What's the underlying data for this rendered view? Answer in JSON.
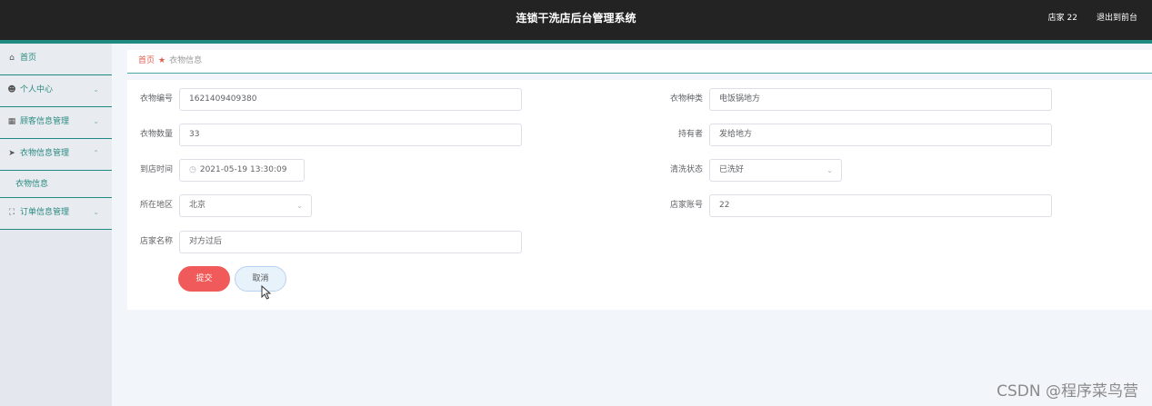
{
  "header": {
    "title": "连锁干洗店后台管理系统",
    "user": "店家 22",
    "exit": "退出到前台"
  },
  "sidebar": {
    "items": [
      {
        "icon": "home-icon",
        "label": "首页"
      },
      {
        "icon": "user-icon",
        "label": "个人中心"
      },
      {
        "icon": "document-icon",
        "label": "顾客信息管理"
      },
      {
        "icon": "send-icon",
        "label": "衣物信息管理",
        "expanded": true,
        "children": [
          {
            "label": "衣物信息"
          }
        ]
      },
      {
        "icon": "frame-icon",
        "label": "订单信息管理"
      }
    ]
  },
  "breadcrumb": {
    "home": "首页",
    "current": "衣物信息"
  },
  "form": {
    "clothing_no_label": "衣物编号",
    "clothing_no_value": "1621409409380",
    "clothing_type_label": "衣物种类",
    "clothing_type_value": "电饭锅地方",
    "clothing_qty_label": "衣物数量",
    "clothing_qty_value": "33",
    "owner_label": "持有者",
    "owner_value": "发给地方",
    "arrival_label": "到店时间",
    "arrival_value": "2021-05-19 13:30:09",
    "wash_status_label": "清洗状态",
    "wash_status_value": "已洗好",
    "region_label": "所在地区",
    "region_value": "北京",
    "store_account_label": "店家账号",
    "store_account_value": "22",
    "store_name_label": "店家名称",
    "store_name_value": "对方过后",
    "submit": "提交",
    "cancel": "取消"
  },
  "watermark": "CSDN @程序菜鸟营"
}
